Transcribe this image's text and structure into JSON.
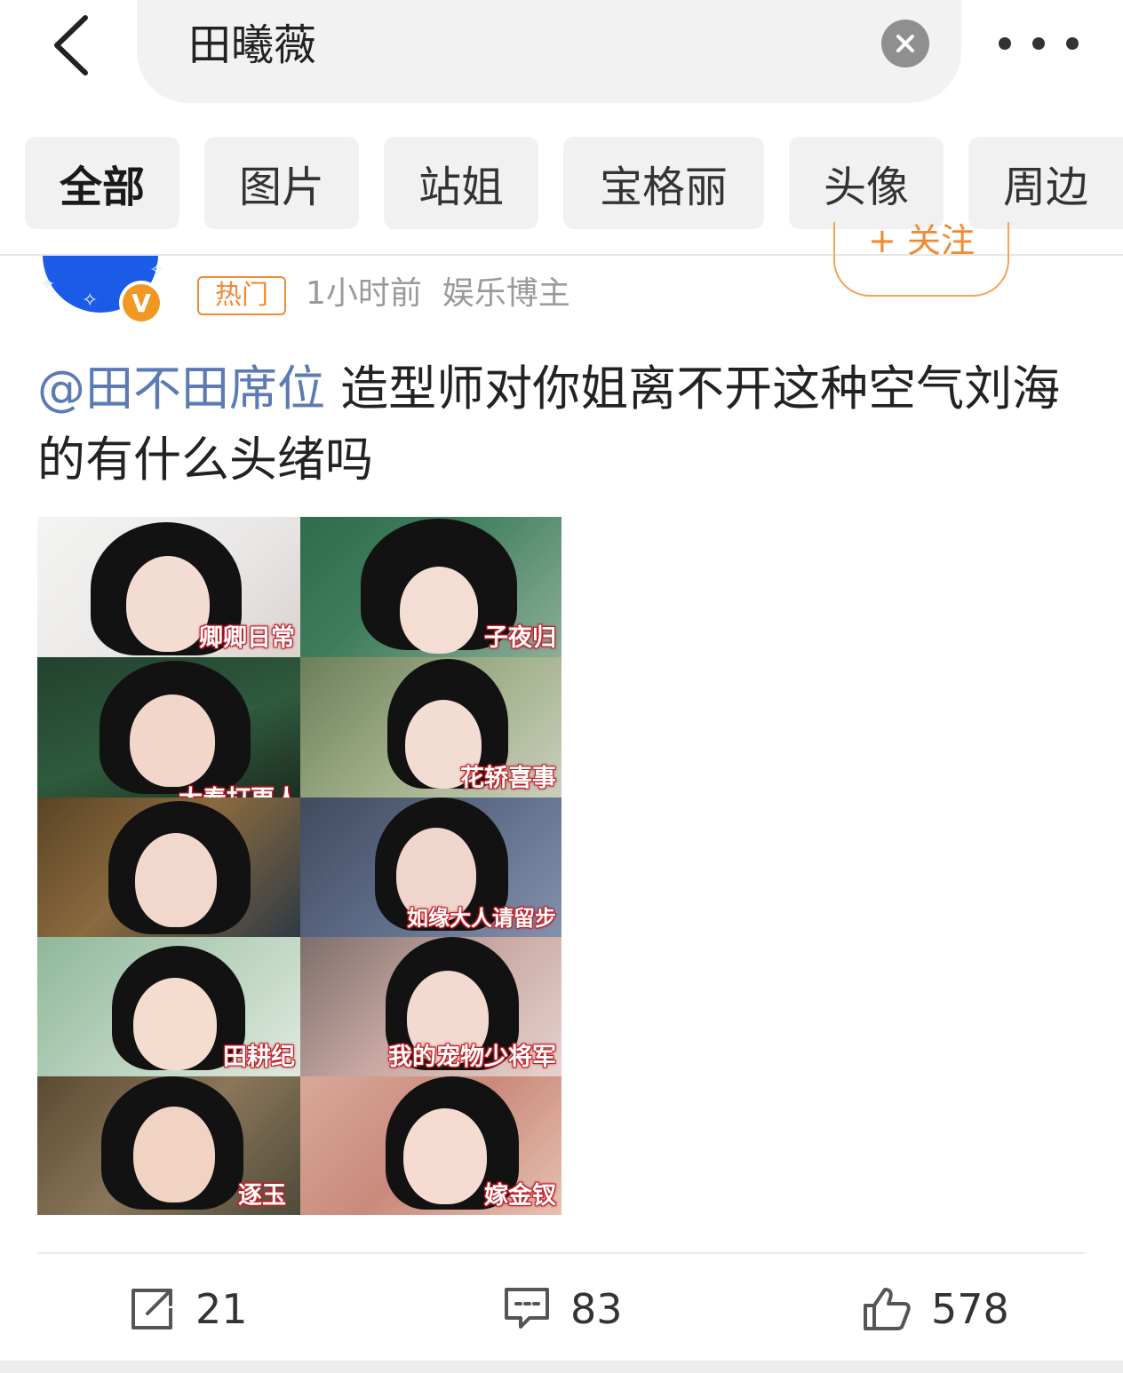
{
  "header": {
    "search_query": "田曦薇",
    "icons": {
      "back": "chevron-left-icon",
      "clear": "clear-x-icon",
      "more": "more-dots-icon"
    }
  },
  "tabs": [
    {
      "label": "全部",
      "active": true
    },
    {
      "label": "图片",
      "active": false
    },
    {
      "label": "站姐",
      "active": false
    },
    {
      "label": "宝格丽",
      "active": false
    },
    {
      "label": "头像",
      "active": false
    },
    {
      "label": "周边",
      "active": false
    }
  ],
  "post": {
    "hot_tag": "热门",
    "time_and_role": "1小时前  娱乐博主",
    "follow_label": "+ 关注",
    "verified_badge": "V",
    "mention": "@田不田席位",
    "text": " 造型师对你姐离不开这种空气刘海的有什么头绪吗",
    "images": [
      {
        "caption": "卿卿日常"
      },
      {
        "caption": "子夜归"
      },
      {
        "caption": "大奉打更人"
      },
      {
        "caption": "花轿喜事"
      },
      {
        "caption": ""
      },
      {
        "caption": "如缘大人请留步"
      },
      {
        "caption": "田耕纪"
      },
      {
        "caption": "我的宠物少将军"
      },
      {
        "caption": "逐玉"
      },
      {
        "caption": "嫁金钗"
      }
    ]
  },
  "actions": {
    "repost_count": "21",
    "comment_count": "83",
    "like_count": "578"
  },
  "colors": {
    "accent_orange": "#f08a34",
    "mention_blue": "#5b7bb4",
    "avatar_blue": "#1a5be8"
  }
}
